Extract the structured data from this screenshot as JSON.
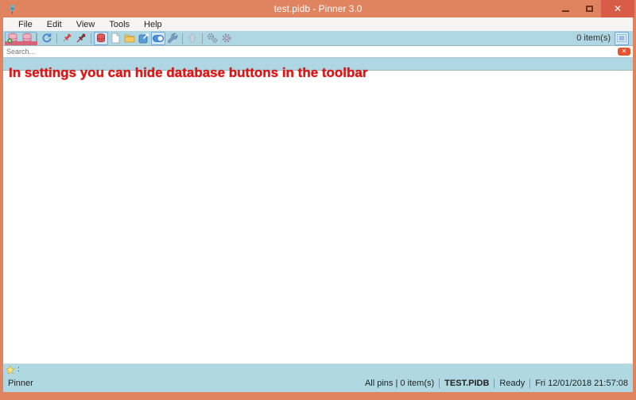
{
  "window": {
    "title": "test.pidb - Pinner 3.0",
    "controls": {
      "minimize": "",
      "maximize": "",
      "close": "✕"
    }
  },
  "menu": {
    "items": [
      "File",
      "Edit",
      "View",
      "Tools",
      "Help"
    ]
  },
  "toolbar": {
    "count_label": "0 item(s)",
    "buttons": [
      "add-database",
      "database",
      "refresh",
      "pin",
      "unpin",
      "database-view",
      "new-file",
      "open-folder",
      "export",
      "toggle-switch",
      "tools-wrench",
      "upload",
      "plugins-gears",
      "settings-gear",
      "list-view"
    ]
  },
  "search": {
    "placeholder": "Search..."
  },
  "annotation": {
    "text": "In settings you can hide database buttons in the toolbar"
  },
  "statusbar": {
    "tag_label": ":",
    "app_name": "Pinner",
    "pins_summary": "All pins | 0 item(s)",
    "db_name": "TEST.PIDB",
    "state": "Ready",
    "datetime": "Fri 12/01/2018 21:57:08"
  },
  "colors": {
    "window_border": "#e0835f",
    "close_button": "#d95c49",
    "toolbar_bg": "#aed7e3",
    "status_bg": "#b0d8e2",
    "annotation_red": "#e01414",
    "search_clear": "#e8512e",
    "highlight_blue": "#6ea6d8",
    "db_underline": "#e0586e"
  }
}
